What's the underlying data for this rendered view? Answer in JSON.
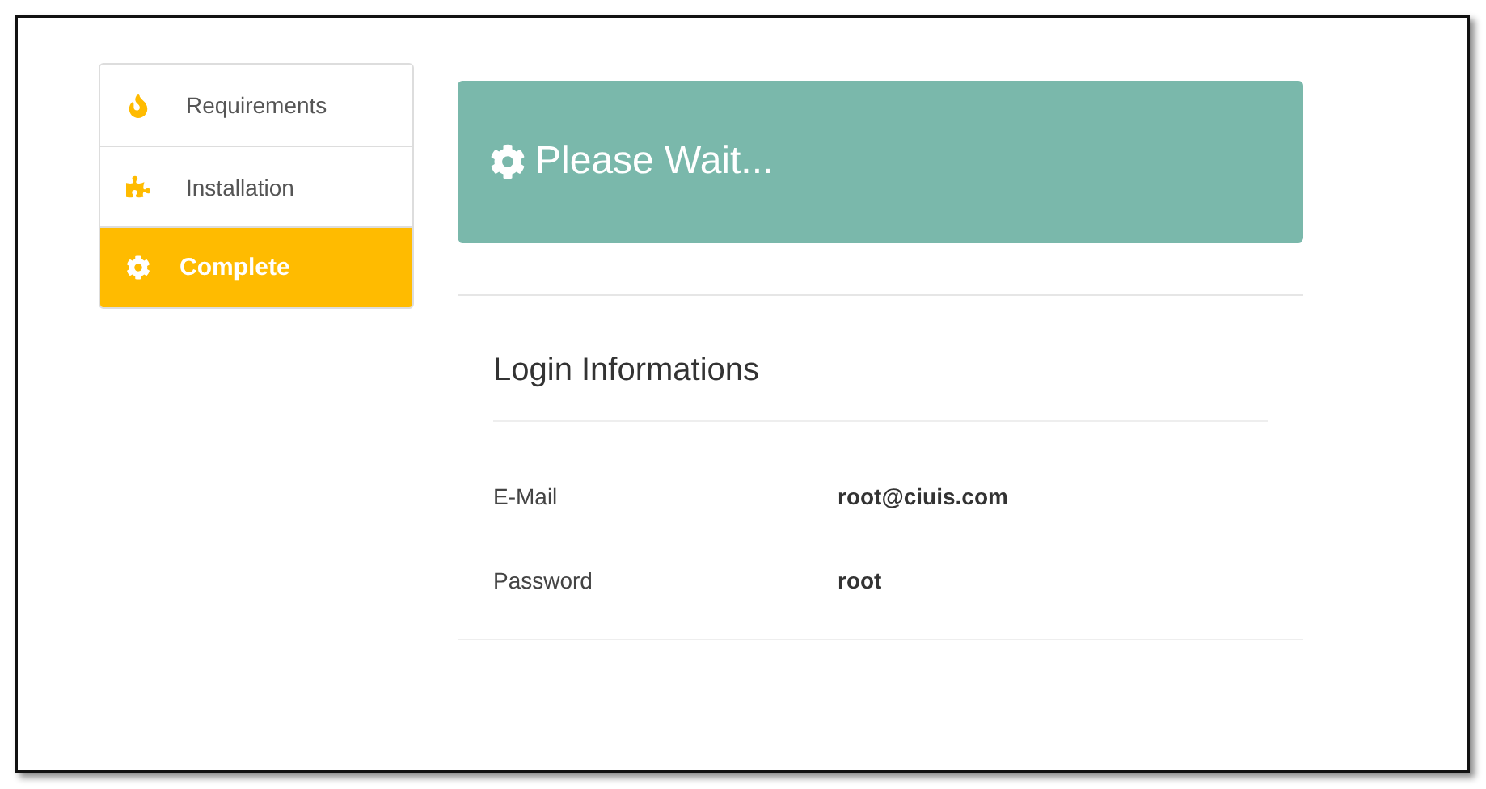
{
  "steps": [
    {
      "label": "Requirements",
      "selected": false
    },
    {
      "label": "Installation",
      "selected": false
    },
    {
      "label": "Complete",
      "selected": true
    }
  ],
  "banner": {
    "title": "Please Wait..."
  },
  "login": {
    "title": "Login Informations",
    "rows": [
      {
        "label": "E-Mail",
        "value": "root@ciuis.com"
      },
      {
        "label": "Password",
        "value": "root"
      }
    ]
  }
}
